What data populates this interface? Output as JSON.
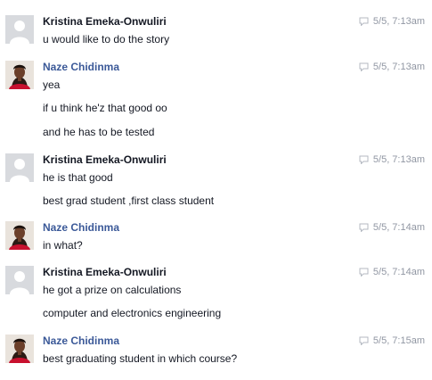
{
  "messages": [
    {
      "sender": "Kristina Emeka-Onwuliri",
      "timestamp": "5/5, 7:13am",
      "lines": [
        "u would like to do the story"
      ]
    },
    {
      "sender": "Naze Chidinma",
      "timestamp": "5/5, 7:13am",
      "lines": [
        "yea",
        "if u think he'z that good oo",
        "and he has to be tested"
      ]
    },
    {
      "sender": "Kristina Emeka-Onwuliri",
      "timestamp": "5/5, 7:13am",
      "lines": [
        "he is that good",
        "best grad student ,first class student"
      ]
    },
    {
      "sender": "Naze Chidinma",
      "timestamp": "5/5, 7:14am",
      "lines": [
        "in what?"
      ]
    },
    {
      "sender": "Kristina Emeka-Onwuliri",
      "timestamp": "5/5, 7:14am",
      "lines": [
        "he got a prize on calculations",
        "computer and electronics engineering"
      ]
    },
    {
      "sender": "Naze Chidinma",
      "timestamp": "5/5, 7:15am",
      "lines": [
        "best graduating student in which course?"
      ]
    }
  ],
  "icons": {
    "timestamp": "chat-bubble-icon",
    "default_avatar": "default-profile-silhouette",
    "photo_avatar": "profile-photo"
  },
  "colors": {
    "sender_blue": "#3b5998",
    "sender_dark": "#141823",
    "timestamp_gray": "#9197a3",
    "avatar_placeholder": "#d8dade"
  }
}
